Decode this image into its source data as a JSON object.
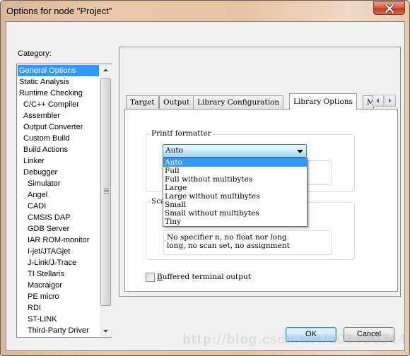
{
  "window": {
    "title": "Options for node \"Project\"",
    "close_icon": "close-icon"
  },
  "category": {
    "label": "Category:",
    "selected": "General Options",
    "items": [
      {
        "label": "General Options",
        "level": 0
      },
      {
        "label": "Static Analysis",
        "level": 0
      },
      {
        "label": "Runtime Checking",
        "level": 0
      },
      {
        "label": "C/C++ Compiler",
        "level": 1
      },
      {
        "label": "Assembler",
        "level": 1
      },
      {
        "label": "Output Converter",
        "level": 1
      },
      {
        "label": "Custom Build",
        "level": 1
      },
      {
        "label": "Build Actions",
        "level": 1
      },
      {
        "label": "Linker",
        "level": 1
      },
      {
        "label": "Debugger",
        "level": 1
      },
      {
        "label": "Simulator",
        "level": 2
      },
      {
        "label": "Angel",
        "level": 2
      },
      {
        "label": "CADI",
        "level": 2
      },
      {
        "label": "CMSIS DAP",
        "level": 2
      },
      {
        "label": "GDB Server",
        "level": 2
      },
      {
        "label": "IAR ROM-monitor",
        "level": 2
      },
      {
        "label": "I-jet/JTAGjet",
        "level": 2
      },
      {
        "label": "J-Link/J-Trace",
        "level": 2
      },
      {
        "label": "TI Stellaris",
        "level": 2
      },
      {
        "label": "Macraigor",
        "level": 2
      },
      {
        "label": "PE micro",
        "level": 2
      },
      {
        "label": "RDI",
        "level": 2
      },
      {
        "label": "ST-LINK",
        "level": 2
      },
      {
        "label": "Third-Party Driver",
        "level": 2
      }
    ]
  },
  "tabs": {
    "items": [
      {
        "label": "Target"
      },
      {
        "label": "Output"
      },
      {
        "label": "Library Configuration"
      },
      {
        "label": "Library Options"
      },
      {
        "label": "MISRA"
      }
    ],
    "active": "Library Options",
    "scroll_left_icon": "arrow-left-icon",
    "scroll_right_icon": "arrow-right-icon"
  },
  "printf": {
    "group_title": "Printf formatter",
    "selected": "Auto",
    "options": [
      "Auto",
      "Full",
      "Full without multibytes",
      "Large",
      "Large without multibytes",
      "Small",
      "Small without multibytes",
      "Tiny"
    ],
    "description": ""
  },
  "scanf": {
    "group_title": "Scanf formatter",
    "description": "No specifier n, no float nor long\nlong, no scan set, no assignment"
  },
  "buffered_output": {
    "label_accel": "B",
    "label_rest": "uffered terminal output",
    "checked": false
  },
  "buttons": {
    "ok": "OK",
    "cancel": "Cancel"
  },
  "watermark": "http://blog.csdn.net/u011303443"
}
